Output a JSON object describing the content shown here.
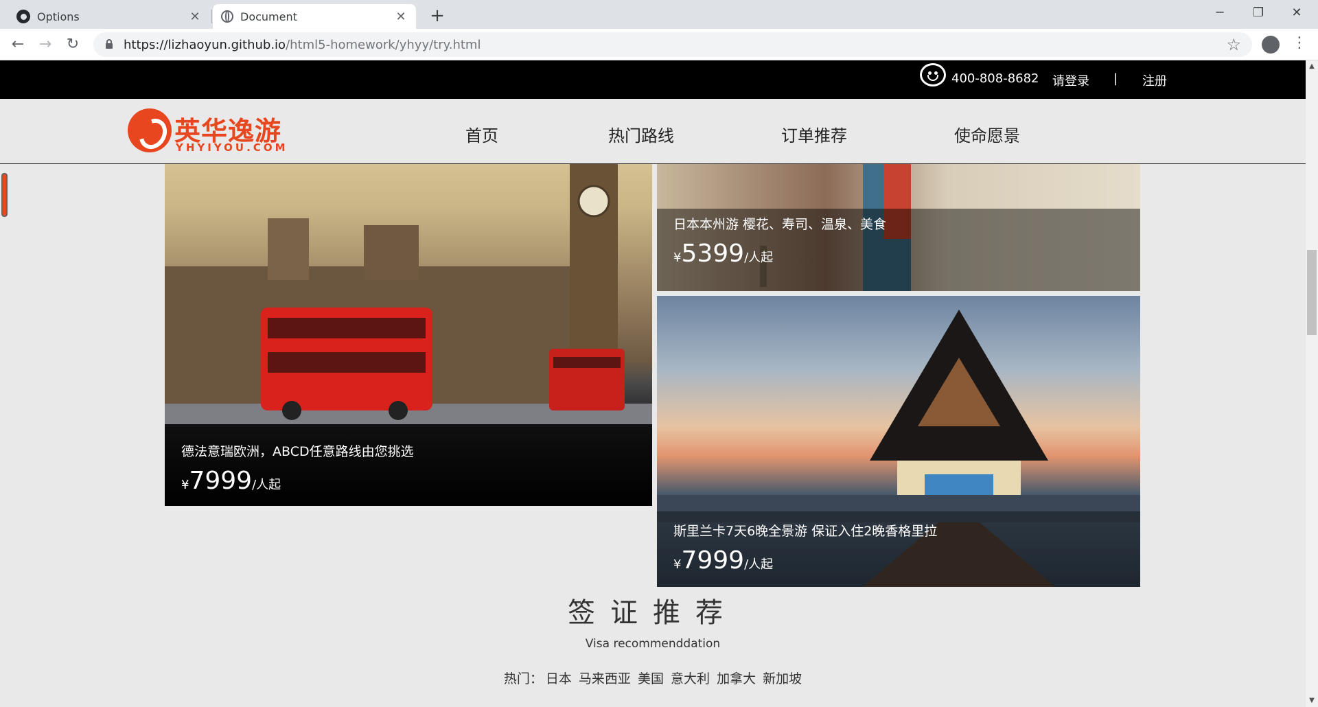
{
  "browser": {
    "tabs": [
      {
        "title": "Options",
        "icon": "github-icon"
      },
      {
        "title": "Document",
        "icon": "globe-icon"
      }
    ],
    "url_host": "https://lizhaoyun.github.io",
    "url_path": "/html5-homework/yhyy/try.html"
  },
  "topbar": {
    "phone": "400-808-8682",
    "login": "请登录",
    "divider": "|",
    "register": "注册"
  },
  "logo": {
    "cn": "英华逸游",
    "en": "YHYIYOU.COM"
  },
  "nav": [
    "首页",
    "热门路线",
    "订单推荐",
    "使命愿景"
  ],
  "cards": {
    "europe": {
      "title": "德法意瑞欧洲，ABCD任意路线由您挑选",
      "currency": "¥",
      "price": "7999",
      "unit": "/人起"
    },
    "japan": {
      "title": "日本本州游 樱花、寿司、温泉、美食",
      "currency": "¥",
      "price": "5399",
      "unit": "/人起"
    },
    "srilanka": {
      "title": "斯里兰卡7天6晚全景游 保证入住2晚香格里拉",
      "currency": "¥",
      "price": "7999",
      "unit": "/人起"
    }
  },
  "visa": {
    "title": "签证推荐",
    "subtitle": "Visa recommenddation",
    "hot_label": "热门：",
    "countries": [
      "日本",
      "马来西亚",
      "美国",
      "意大利",
      "加拿大",
      "新加坡"
    ]
  },
  "colors": {
    "brand": "#e8461e",
    "topbar": "#000000",
    "page_bg": "#e9e9e9"
  }
}
